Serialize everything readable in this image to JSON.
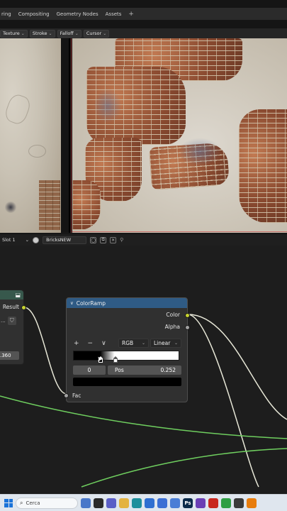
{
  "workspace_tabs": [
    "ring",
    "Compositing",
    "Geometry Nodes",
    "Assets"
  ],
  "workspace_add": "+",
  "image_toolbar": {
    "items": [
      "Texture",
      "Stroke",
      "Falloff",
      "Cursor"
    ]
  },
  "node_header": {
    "slot": "Slot 1",
    "material": "BricksNEW"
  },
  "left_node": {
    "output_label": "Result",
    "dots": "...",
    "value": ".360"
  },
  "color_ramp": {
    "title": "ColorRamp",
    "outputs": {
      "color": "Color",
      "alpha": "Alpha"
    },
    "add": "+",
    "remove": "−",
    "menu": "∨",
    "color_mode": "RGB",
    "interpolation": "Linear",
    "stop_index": "0",
    "pos_label": "Pos",
    "pos_value": "0.252",
    "input_label": "Fac",
    "stop_positions": [
      0.252,
      0.39
    ],
    "selected_color": "#000000"
  },
  "taskbar": {
    "search_placeholder": "Cerca",
    "apps": [
      {
        "icon": "widgets-icon",
        "color": "#4a78c9"
      },
      {
        "icon": "task-view-icon",
        "color": "#2a2a2a"
      },
      {
        "icon": "teams-icon",
        "color": "#5b5fc7"
      },
      {
        "icon": "file-explorer-icon",
        "color": "#e3b341"
      },
      {
        "icon": "edge-icon",
        "color": "#1e8f9c"
      },
      {
        "icon": "store-icon",
        "color": "#2f6fd1"
      },
      {
        "icon": "save-icon",
        "color": "#3b6fd4"
      },
      {
        "icon": "windows-app-icon",
        "color": "#4a7ed6"
      },
      {
        "icon": "photoshop-icon",
        "color": "#0a2a4a"
      },
      {
        "icon": "film-icon",
        "color": "#6a3fb5"
      },
      {
        "icon": "acrobat-icon",
        "color": "#c8281f"
      },
      {
        "icon": "chrome-icon",
        "color": "#2f9e44"
      },
      {
        "icon": "file-manager-icon",
        "color": "#3a3a3a"
      },
      {
        "icon": "blender-icon",
        "color": "#e87d0d"
      }
    ],
    "app_labels": [
      "",
      "",
      "",
      "",
      "",
      "",
      "",
      "",
      "Ps",
      "",
      "",
      "",
      "",
      ""
    ]
  },
  "colors": {
    "node_socket_color": "#c7d330",
    "node_socket_gray": "#a1a1a1",
    "link_green": "#6fcf5f",
    "link_white": "#e8e8d8",
    "colorramp_header": "#2f5b85"
  }
}
